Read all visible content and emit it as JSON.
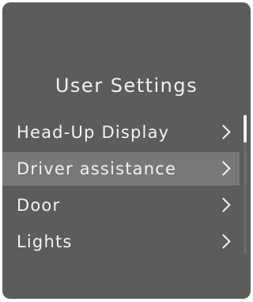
{
  "screen": {
    "title": "User Settings",
    "background_color": "#5c5c5c",
    "selected_color": "#787878"
  },
  "menu": {
    "items": [
      {
        "label": "Head-Up Display",
        "icon": "chevron-right-icon",
        "selected": false
      },
      {
        "label": "Driver assistance",
        "icon": "chevron-right-icon",
        "selected": true
      },
      {
        "label": "Door",
        "icon": "chevron-right-icon",
        "selected": false
      },
      {
        "label": "Lights",
        "icon": "chevron-right-icon",
        "selected": false
      }
    ]
  },
  "scrollbar": {
    "position_fraction": 0.0,
    "visible_fraction": 0.2
  }
}
